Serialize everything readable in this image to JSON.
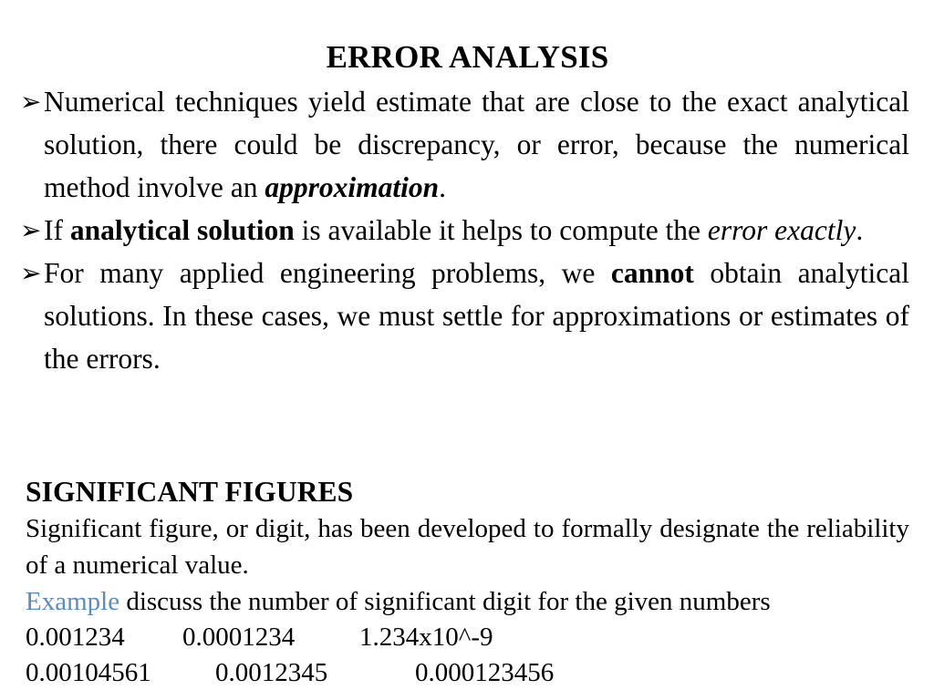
{
  "slide": {
    "title": "ERROR ANALYSIS",
    "bullet_marker": "➢",
    "bullets": [
      {
        "parts": [
          {
            "text": "Numerical techniques yield estimate that are close to the exact analytical solution, there could be discrepancy, or error, because the numerical method involve an ",
            "style": "regular"
          },
          {
            "text": "approximation",
            "style": "bold-italic"
          },
          {
            "text": ".",
            "style": "regular"
          }
        ]
      },
      {
        "parts": [
          {
            "text": "If ",
            "style": "regular"
          },
          {
            "text": "analytical solution",
            "style": "bold"
          },
          {
            "text": " is available it helps to compute the ",
            "style": "regular"
          },
          {
            "text": "error exactly",
            "style": "italic"
          },
          {
            "text": ".",
            "style": "regular"
          }
        ]
      },
      {
        "parts": [
          {
            "text": "For many applied engineering problems, we ",
            "style": "regular"
          },
          {
            "text": "cannot",
            "style": "bold"
          },
          {
            "text": " obtain analytical solutions. In these cases, we must settle for approximations or estimates of the errors.",
            "style": "regular"
          }
        ]
      }
    ],
    "section_heading": "SIGNIFICANT FIGURES",
    "definition": "Significant figure, or digit, has been developed to formally designate the reliability of a numerical value.",
    "example_keyword": "Example",
    "example_text": " discuss the number of significant digit for the given numbers",
    "number_rows": [
      [
        "0.001234",
        "0.0001234",
        "1.234x10^-9"
      ],
      [
        "0.00104561",
        "0.0012345",
        "0.000123456"
      ]
    ],
    "colors": {
      "text": "#000000",
      "background": "#ffffff",
      "example_accent": "#5b8bc4"
    }
  }
}
